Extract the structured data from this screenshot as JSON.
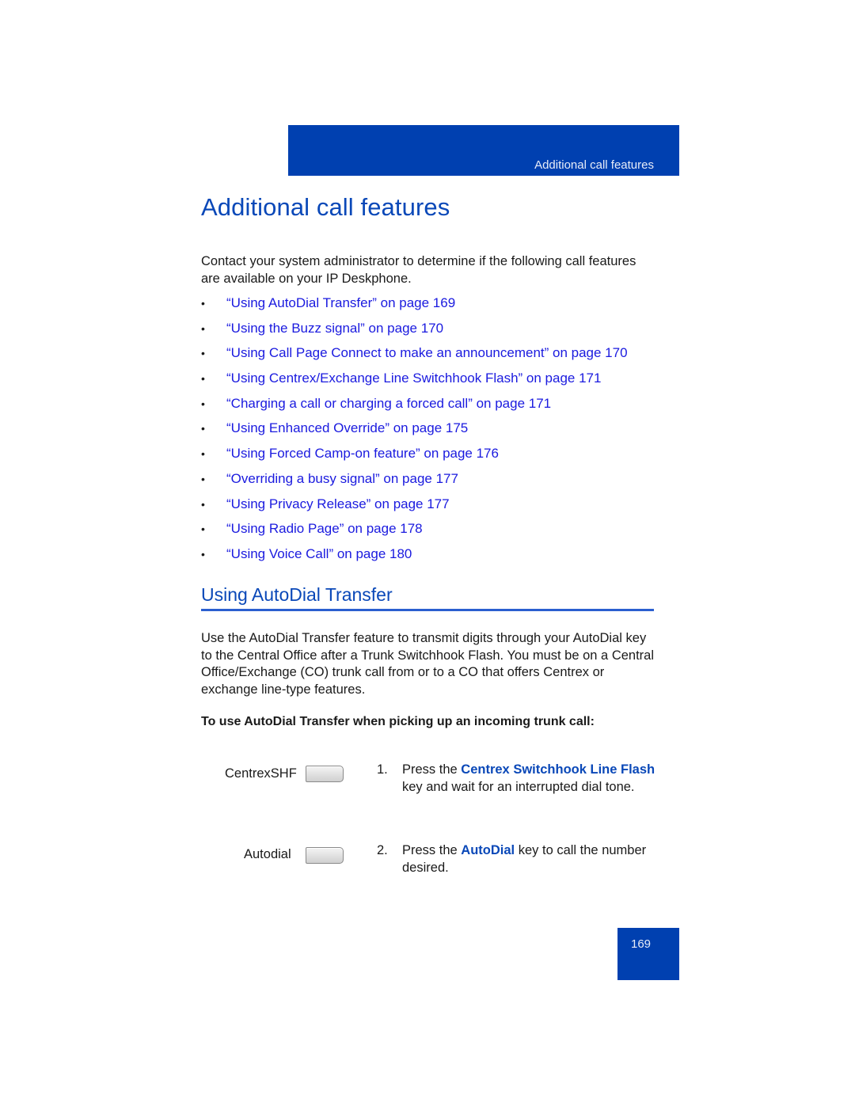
{
  "header": {
    "running_title": "Additional call features",
    "band_color": "#0040b0"
  },
  "page_title": "Additional call features",
  "intro": "Contact your system administrator to determine if the following call features are available on your IP Deskphone.",
  "feature_links": [
    {
      "label": "“Using AutoDial Transfer” on page 169"
    },
    {
      "label": "“Using the Buzz signal” on page 170"
    },
    {
      "label": "“Using Call Page Connect to make an announcement” on page 170"
    },
    {
      "label": "“Using Centrex/Exchange Line Switchhook Flash” on page 171"
    },
    {
      "label": "“Charging a call or charging a forced call” on page 171"
    },
    {
      "label": "“Using Enhanced Override” on page 175"
    },
    {
      "label": "“Using Forced Camp-on feature” on page 176"
    },
    {
      "label": "“Overriding a busy signal” on page 177"
    },
    {
      "label": "“Using Privacy Release” on page 177"
    },
    {
      "label": "“Using Radio Page” on page 178"
    },
    {
      "label": "“Using Voice Call” on page 180"
    }
  ],
  "bullet_glyph": "•",
  "section": {
    "title": "Using AutoDial Transfer",
    "body": "Use the AutoDial Transfer feature to transmit digits through your AutoDial key to the Central Office after a Trunk Switchhook Flash. You must be on a Central Office/Exchange (CO) trunk call from or to a CO that offers Centrex or exchange line-type features.",
    "procedure_heading": "To use AutoDial Transfer when picking up an incoming trunk call:",
    "steps": [
      {
        "key_label": "CentrexSHF",
        "number": "1.",
        "prefix": "Press the ",
        "key_name": "Centrex Switchhook Line Flash",
        "suffix": " key and wait for an interrupted dial tone."
      },
      {
        "key_label": "Autodial",
        "number": "2.",
        "prefix": "Press the ",
        "key_name": "AutoDial",
        "suffix": " key to call the number desired."
      }
    ]
  },
  "footer": {
    "page_number": "169"
  },
  "colors": {
    "accent_blue": "#0040b0",
    "heading_blue": "#0a48b8",
    "link_blue": "#1a1adf"
  }
}
